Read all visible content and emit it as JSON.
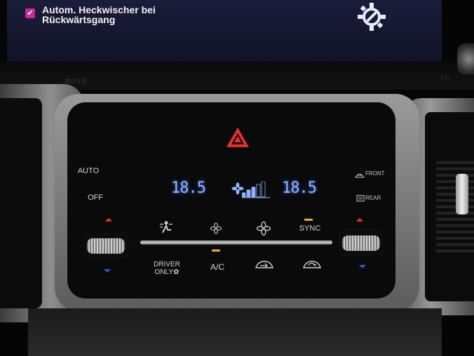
{
  "screen": {
    "checkbox_checked": true,
    "checkbox_label_line1": "Autom. Heckwischer bei",
    "checkbox_label_line2": "Rückwärtsgang",
    "settings_icon": "gear-wrench-icon"
  },
  "climate": {
    "left_temp": "18.5",
    "right_temp": "18.5",
    "fan_level": 3,
    "fan_levels_total": 5,
    "left_buttons": {
      "auto_label": "AUTO",
      "off_label": "OFF"
    },
    "right_buttons": {
      "front_label": "FRONT",
      "rear_label": "REAR"
    },
    "sync_label": "SYNC",
    "ac_label": "A/C",
    "driver_only_line1": "DRIVER",
    "driver_only_line2": "ONLY",
    "indicator_color": "#f0b02c",
    "temp_color": "#8fb4ff",
    "hazard_color": "#e63030"
  }
}
